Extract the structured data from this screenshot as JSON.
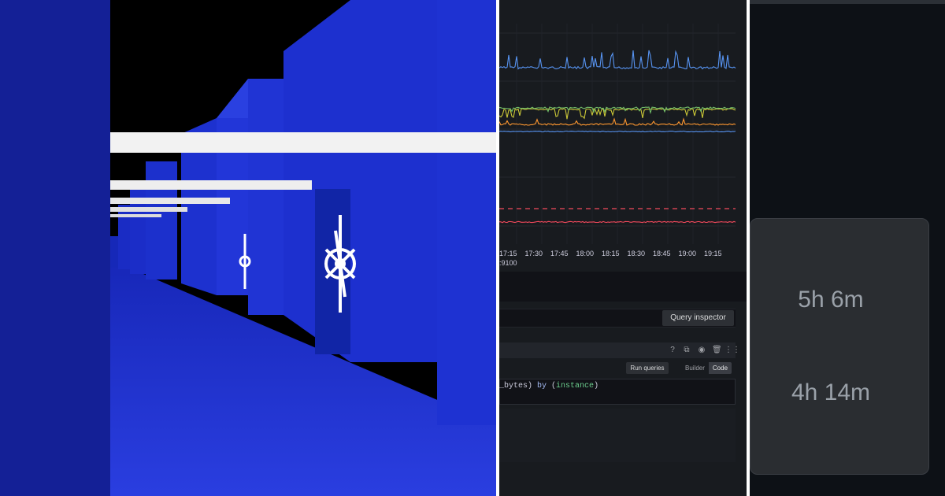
{
  "dashboard": {
    "time_ticks": [
      "17:15",
      "17:30",
      "17:45",
      "18:00",
      "18:15",
      "18:30",
      "18:45",
      "19:00",
      "19:15"
    ],
    "legend_fragment": ":9100",
    "query_inspector_label": "Query inspector",
    "run_queries_label": "Run queries",
    "mode_options": [
      "Builder",
      "Code"
    ],
    "active_mode": "Code",
    "query_code": {
      "prefix": "_bytes) ",
      "keyword": "by",
      "open": " (",
      "label": "instance",
      "close": ")"
    },
    "query_icons": [
      "help-icon",
      "duplicate-icon",
      "eye-icon",
      "trash-icon",
      "drag-handle-icon"
    ],
    "colors": {
      "series_blue": "#5794f2",
      "series_yellow": "#cbc837",
      "series_green": "#73bf69",
      "series_orange": "#ff9830",
      "series_red": "#f2495c",
      "threshold_red": "#f2495c"
    }
  },
  "durations": {
    "items": [
      "5h 6m",
      "4h 14m"
    ]
  },
  "render": {
    "colors": {
      "blue": "#1a2bd0",
      "floor": "#1d33c9",
      "light_bar": "#f2f2f2"
    }
  }
}
